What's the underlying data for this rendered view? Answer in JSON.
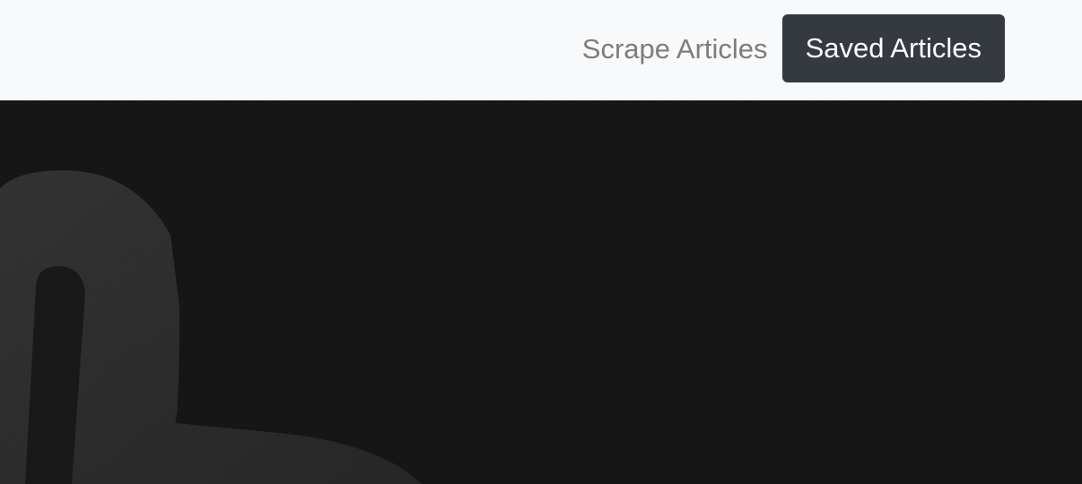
{
  "navbar": {
    "links": {
      "scrape_label": "Scrape Articles",
      "saved_label": "Saved Articles"
    }
  },
  "colors": {
    "navbar_bg": "#f8f9fa",
    "active_button_bg": "#343a40",
    "hero_bg": "#151515",
    "hero_shape": "#2b2b2b"
  },
  "hero": {
    "image": "dark-textured-background-with-embossed-logo"
  }
}
